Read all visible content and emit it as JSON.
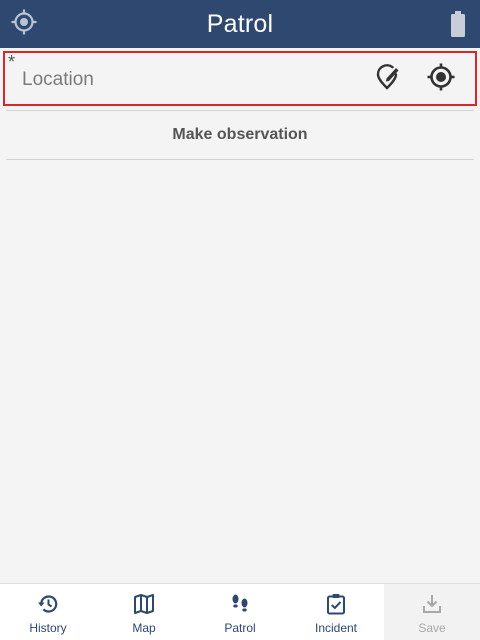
{
  "header": {
    "title": "Patrol",
    "gps_icon": "gps-target-icon",
    "battery_icon": "battery-icon"
  },
  "location_field": {
    "required_mark": "*",
    "placeholder": "Location",
    "edit_icon": "edit-location-icon",
    "current_location_icon": "my-location-icon",
    "border_color": "#d92626"
  },
  "actions": {
    "make_observation": "Make observation"
  },
  "bottom_nav": {
    "items": [
      {
        "label": "History",
        "icon": "history-icon",
        "enabled": true
      },
      {
        "label": "Map",
        "icon": "map-icon",
        "enabled": true
      },
      {
        "label": "Patrol",
        "icon": "footsteps-icon",
        "enabled": true
      },
      {
        "label": "Incident",
        "icon": "clipboard-check-icon",
        "enabled": true
      },
      {
        "label": "Save",
        "icon": "save-download-icon",
        "enabled": false
      }
    ]
  },
  "colors": {
    "header_bg": "#2e4870",
    "nav_active": "#2e4870",
    "nav_disabled": "#a8a8a8",
    "page_bg": "#f4f4f4"
  }
}
